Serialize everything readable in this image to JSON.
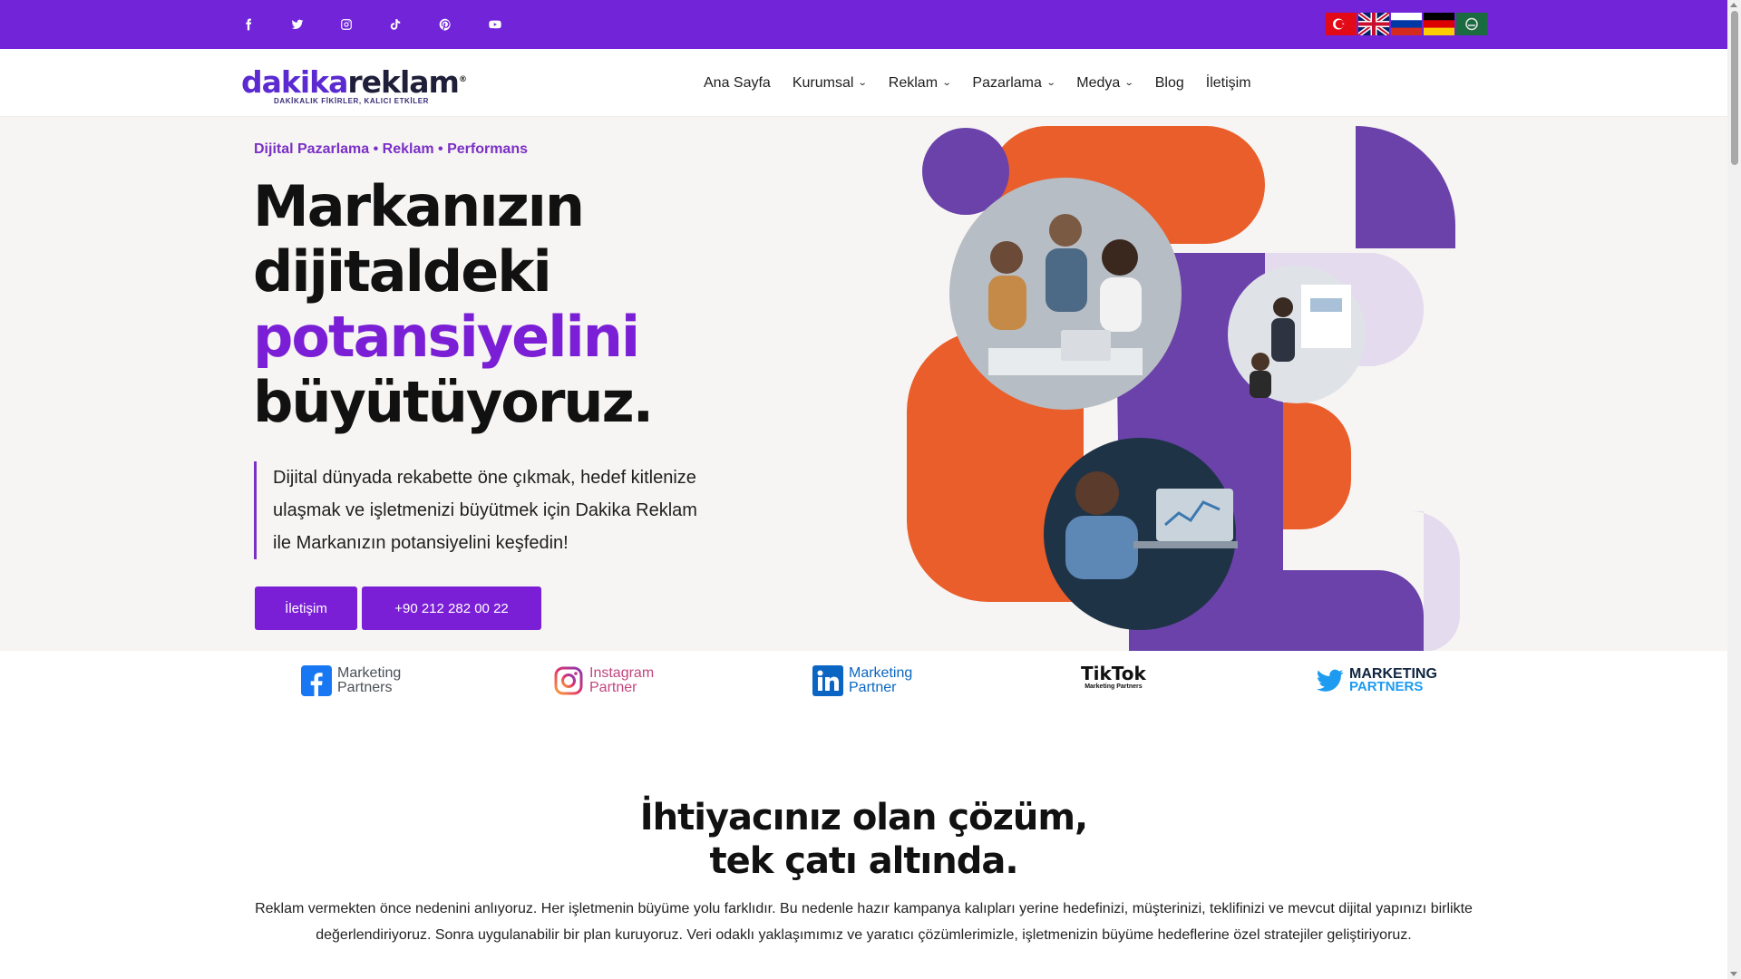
{
  "topbar": {
    "social": [
      "facebook-icon",
      "twitter-icon",
      "instagram-icon",
      "tiktok-icon",
      "pinterest-icon",
      "youtube-icon"
    ],
    "flags": [
      "turkish-flag",
      "english-flag",
      "russian-flag",
      "german-flag",
      "arabic-flag"
    ]
  },
  "logo": {
    "word_d": "dakika",
    "word_r": "reklam",
    "registered": "®",
    "tagline": "DAKİKALIK FİKİRLER, KALICI ETKİLER"
  },
  "nav": {
    "items": [
      {
        "label": "Ana Sayfa",
        "dropdown": false
      },
      {
        "label": "Kurumsal",
        "dropdown": true
      },
      {
        "label": "Reklam",
        "dropdown": true
      },
      {
        "label": "Pazarlama",
        "dropdown": true
      },
      {
        "label": "Medya",
        "dropdown": true
      },
      {
        "label": "Blog",
        "dropdown": false
      },
      {
        "label": "İletişim",
        "dropdown": false
      }
    ],
    "chevron": "⌄"
  },
  "hero": {
    "kicker": "Dijital Pazarlama • Reklam • Performans",
    "title_line1": "Markanızın",
    "title_line2": "dijitaldeki",
    "title_accent": "potansiyelini",
    "title_line4": "büyütüyoruz.",
    "quote": "Dijital dünyada rekabette öne çıkmak, hedef kitlenize ulaşmak ve işletmenizi büyütmek için Dakika Reklam ile Markanızın potansiyelini keşfedin!",
    "btn_contact": "İletişim",
    "btn_phone": "+90 212 282 00 22"
  },
  "partners": {
    "facebook": {
      "line1": "Marketing",
      "line2": "Partners"
    },
    "instagram": {
      "line1": "Instagram",
      "line2": "Partner"
    },
    "linkedin": {
      "line1": "Marketing",
      "line2": "Partner"
    },
    "tiktok": {
      "line1": "TikTok",
      "line2": "Marketing Partners"
    },
    "twitter": {
      "line1": "MARKETING",
      "line2": "PARTNERS"
    }
  },
  "section": {
    "title_line1": "İhtiyacınız olan çözüm,",
    "title_line2": "tek çatı altında.",
    "text": "Reklam vermekten önce nedenini anlıyoruz. Her işletmenin büyüme yolu farklıdır. Bu nedenle hazır kampanya kalıpları yerine hedefinizi, müşterinizi, teklifinizi ve mevcut dijital yapınızı birlikte değerlendiriyoruz. Sonra uygulanabilir bir plan kuruyoruz. Veri odaklı yaklaşımımız ve yaratıcı çözümlerimizle, işletmenizin büyüme hedeflerine özel stratejiler geliştiriyoruz."
  },
  "colors": {
    "brand_purple": "#7124d8",
    "accent_purple": "#7a1fd6",
    "orange": "#e95e2a",
    "lavender": "#e5dbef",
    "deep_purple": "#6a42aa"
  }
}
